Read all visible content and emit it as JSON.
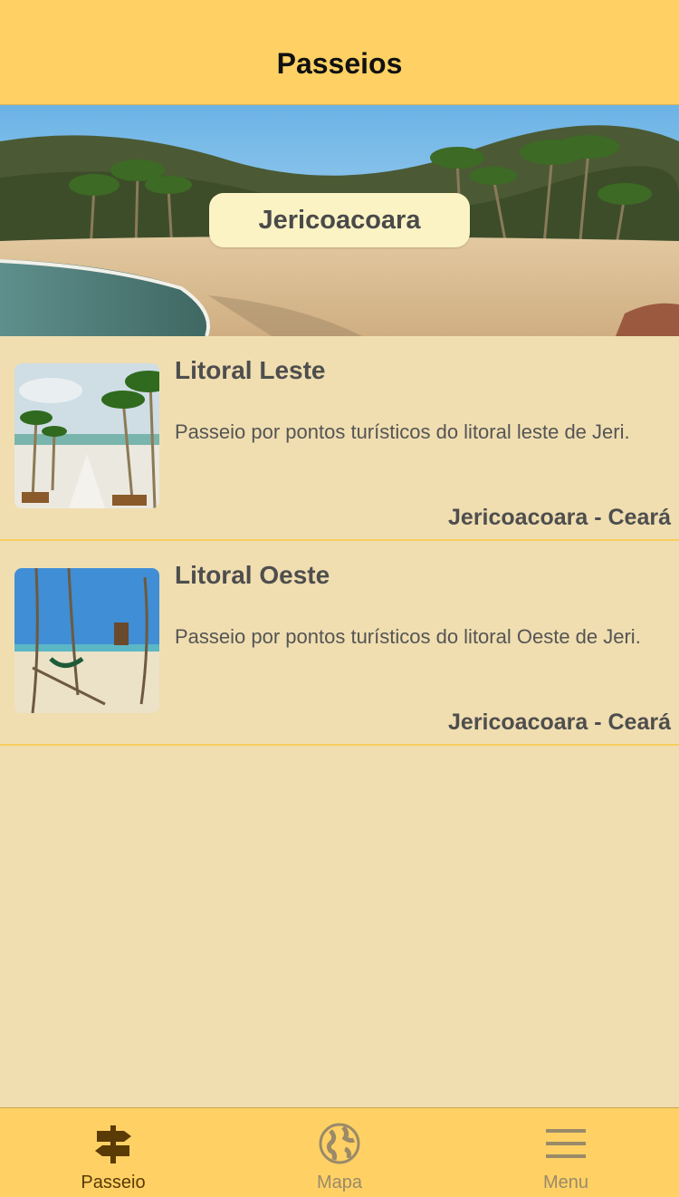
{
  "navbar": {
    "title": "Passeios"
  },
  "hero": {
    "label": "Jericoacoara"
  },
  "tours": [
    {
      "title": "Litoral Leste",
      "description": "Passeio por pontos turísticos do litoral leste de Jeri.",
      "location": "Jericoacoara - Ceará"
    },
    {
      "title": "Litoral Oeste",
      "description": "Passeio por pontos turísticos do litoral Oeste de Jeri.",
      "location": "Jericoacoara - Ceará"
    }
  ],
  "tabbar": {
    "items": [
      {
        "label": "Passeio",
        "icon": "signpost-icon",
        "active": true
      },
      {
        "label": "Mapa",
        "icon": "globe-icon",
        "active": false
      },
      {
        "label": "Menu",
        "icon": "hamburger-menu-icon",
        "active": false
      }
    ]
  },
  "colors": {
    "bar": "#ffd164",
    "background": "#f0deb0",
    "active_tab": "#5a3a05",
    "inactive_tab": "#9a8a6a",
    "separator": "#f7cf5e"
  }
}
